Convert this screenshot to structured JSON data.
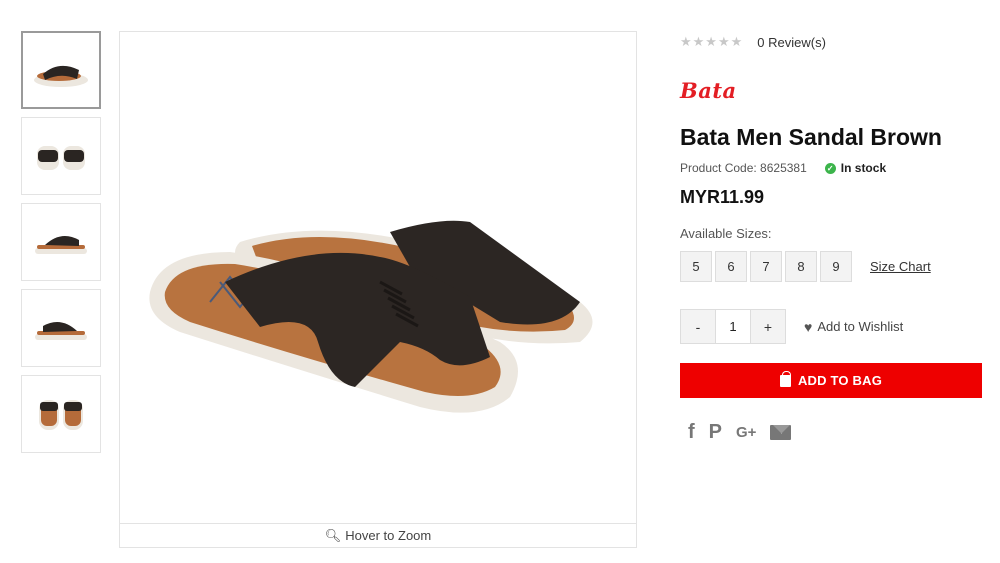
{
  "thumbnails": [
    {
      "view": "side-angle",
      "active": true
    },
    {
      "view": "front",
      "active": false
    },
    {
      "view": "side",
      "active": false
    },
    {
      "view": "side-reverse",
      "active": false
    },
    {
      "view": "back",
      "active": false
    }
  ],
  "main_image": {
    "zoom_label": "Hover to Zoom"
  },
  "product": {
    "stars_filled": 0,
    "stars_total": 5,
    "reviews_label": "0 Review(s)",
    "brand": "Bata",
    "title": "Bata Men Sandal Brown",
    "code_label": "Product Code: 8625381",
    "stock_label": "In stock",
    "price": "MYR11.99",
    "sizes_label": "Available Sizes:",
    "sizes": [
      "5",
      "6",
      "7",
      "8",
      "9"
    ],
    "size_chart_label": "Size Chart",
    "qty_minus": "-",
    "qty_value": "1",
    "qty_plus": "+",
    "wishlist_label": "Add to Wishlist",
    "add_to_bag_label": "ADD TO BAG"
  },
  "social": [
    {
      "icon": "facebook-icon",
      "glyph": "f"
    },
    {
      "icon": "pinterest-icon",
      "glyph": "P"
    },
    {
      "icon": "google-plus-icon",
      "glyph": "G+"
    },
    {
      "icon": "mail-icon",
      "glyph": ""
    }
  ],
  "colors": {
    "brand_red": "#e31e24",
    "button_red": "#ee0000",
    "stock_green": "#3cb44b"
  }
}
